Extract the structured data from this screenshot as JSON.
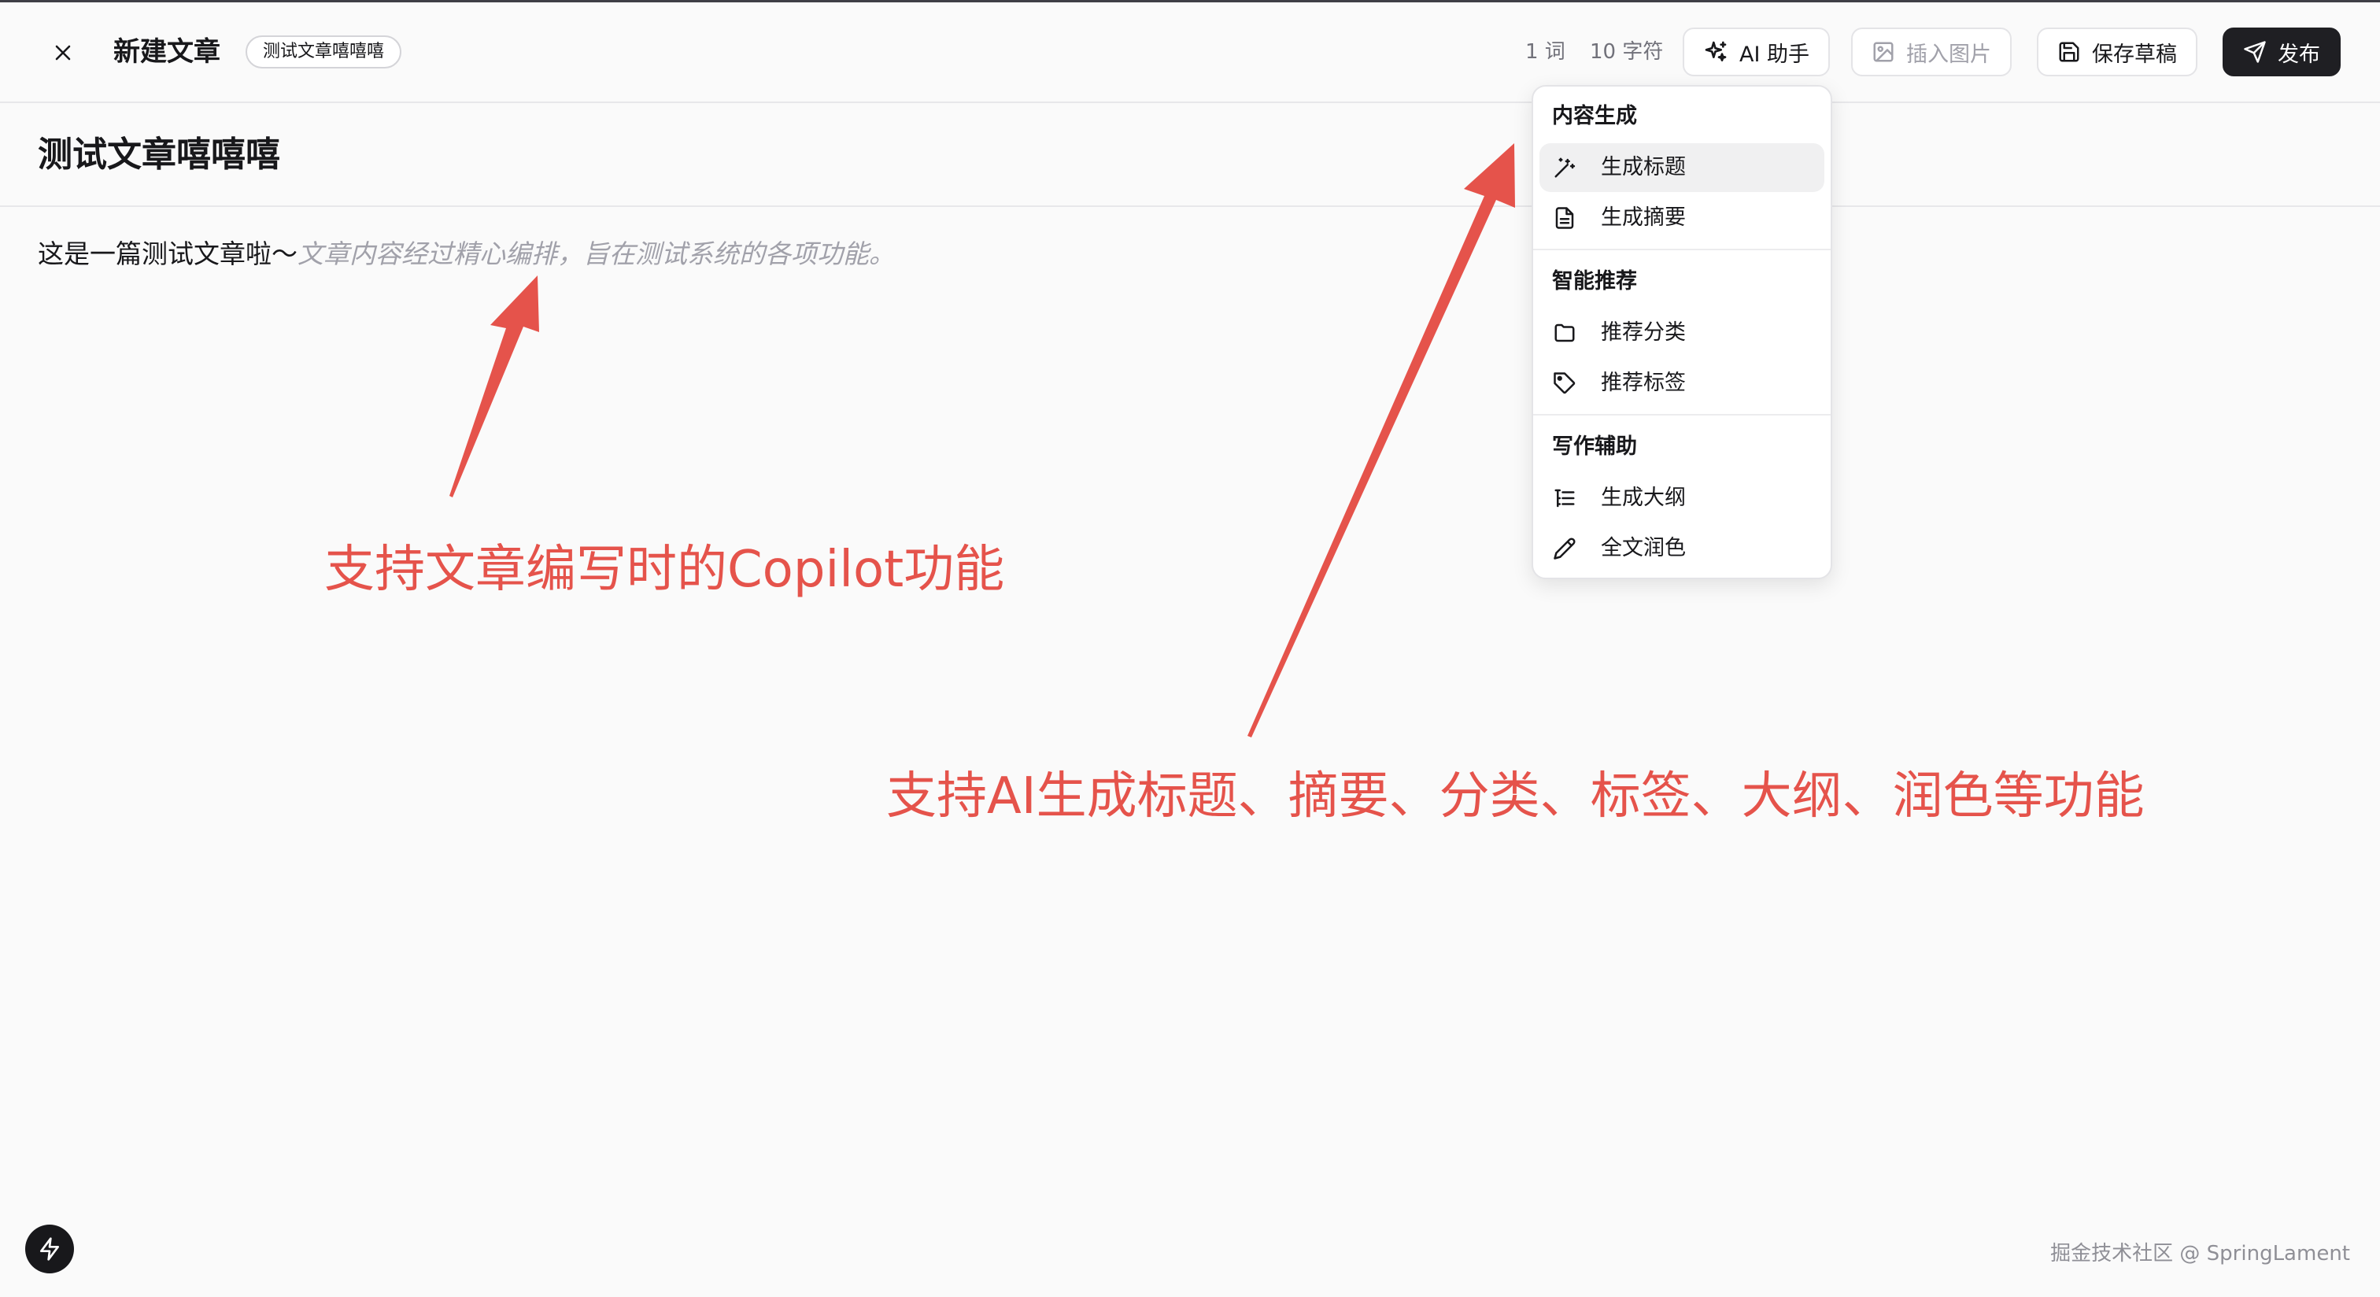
{
  "header": {
    "title": "新建文章",
    "badge": "测试文章嘻嘻嘻",
    "word_count": "1 词",
    "char_count": "10 字符",
    "ai_button": "AI 助手",
    "insert_image_button": "插入图片",
    "save_draft_button": "保存草稿",
    "publish_button": "发布"
  },
  "editor": {
    "title": "测试文章嘻嘻嘻",
    "body_text": "这是一篇测试文章啦～",
    "suggestion_text": "文章内容经过精心编排，旨在测试系统的各项功能。"
  },
  "ai_menu": {
    "groups": [
      {
        "title": "内容生成",
        "items": [
          {
            "label": "生成标题",
            "icon": "magic-wand-icon"
          },
          {
            "label": "生成摘要",
            "icon": "document-icon"
          }
        ]
      },
      {
        "title": "智能推荐",
        "items": [
          {
            "label": "推荐分类",
            "icon": "folder-icon"
          },
          {
            "label": "推荐标签",
            "icon": "tag-icon"
          }
        ]
      },
      {
        "title": "写作辅助",
        "items": [
          {
            "label": "生成大纲",
            "icon": "outline-list-icon"
          },
          {
            "label": "全文润色",
            "icon": "pencil-icon"
          }
        ]
      }
    ]
  },
  "annotations": {
    "copilot": "支持文章编写时的Copilot功能",
    "ai_features": "支持AI生成标题、摘要、分类、标签、大纲、润色等功能"
  },
  "watermark": "掘金技术社区 @ SpringLament",
  "colors": {
    "accent_red": "#e5534b",
    "dark_button": "#1f1f23",
    "suggestion_gray": "#a1a1aa"
  }
}
